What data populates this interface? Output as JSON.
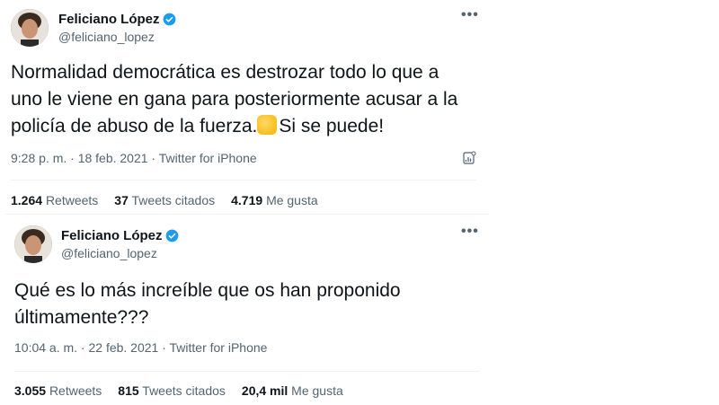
{
  "tweets": [
    {
      "author_name": "Feliciano López",
      "handle": "@feliciano_lopez",
      "text_lines": [
        "Normalidad democrática es destrozar todo lo que a",
        "uno le viene en gana para posteriormente acusar a la",
        "policía de abuso de la fuerza.",
        "Si se puede!"
      ],
      "meta": "9:28 p. m. · 18 feb. 2021 · Twitter for iPhone",
      "stats": {
        "retweets_count": "1.264",
        "retweets_label": "Retweets",
        "quotes_count": "37",
        "quotes_label": "Tweets citados",
        "likes_count": "4.719",
        "likes_label": "Me gusta"
      },
      "icons": [
        "verified-badge-icon",
        "more-options-icon",
        "fist-emoji-icon",
        "analytics-icon"
      ]
    },
    {
      "author_name": "Feliciano López",
      "handle": "@feliciano_lopez",
      "text_lines": [
        "Qué es lo más increíble que os han proponido",
        "últimamente???"
      ],
      "meta": "10:04 a. m. · 22 feb. 2021 · Twitter for iPhone",
      "stats": {
        "retweets_count": "3.055",
        "retweets_label": "Retweets",
        "quotes_count": "815",
        "quotes_label": "Tweets citados",
        "likes_count": "20,4 mil",
        "likes_label": "Me gusta"
      },
      "icons": [
        "verified-badge-icon",
        "more-options-icon"
      ]
    }
  ],
  "more_glyph": "•••",
  "colors": {
    "verified": "#1d9bf0",
    "secondary_text": "#536471",
    "primary_text": "#0f1419"
  }
}
